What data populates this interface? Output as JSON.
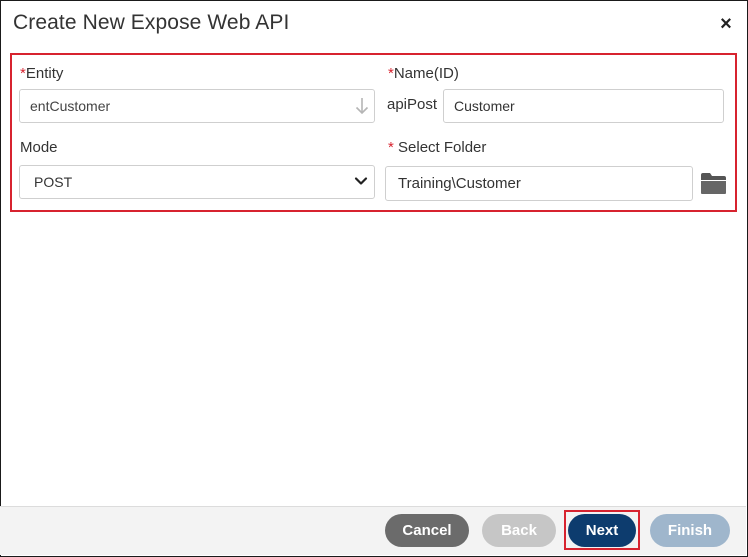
{
  "dialog": {
    "title": "Create New Expose Web API",
    "close_glyph": "×"
  },
  "form": {
    "required_mark": "*",
    "entity": {
      "label": "Entity",
      "value": "entCustomer",
      "icon": "arrow-down-icon"
    },
    "name": {
      "label": "Name(ID)",
      "prefix": "apiPost",
      "value": "Customer"
    },
    "mode": {
      "label": "Mode",
      "value": "POST",
      "icon": "chevron-down-icon"
    },
    "folder": {
      "label": "Select Folder",
      "value": "Training\\Customer",
      "icon": "folder-icon"
    }
  },
  "footer": {
    "cancel_label": "Cancel",
    "back_label": "Back",
    "next_label": "Next",
    "finish_label": "Finish"
  },
  "colors": {
    "highlight": "#d7232f",
    "primary": "#0d3c6e",
    "cancel": "#6b6b6b",
    "disabled_back": "#c6c6c6",
    "disabled_finish": "#9fb6cc"
  }
}
